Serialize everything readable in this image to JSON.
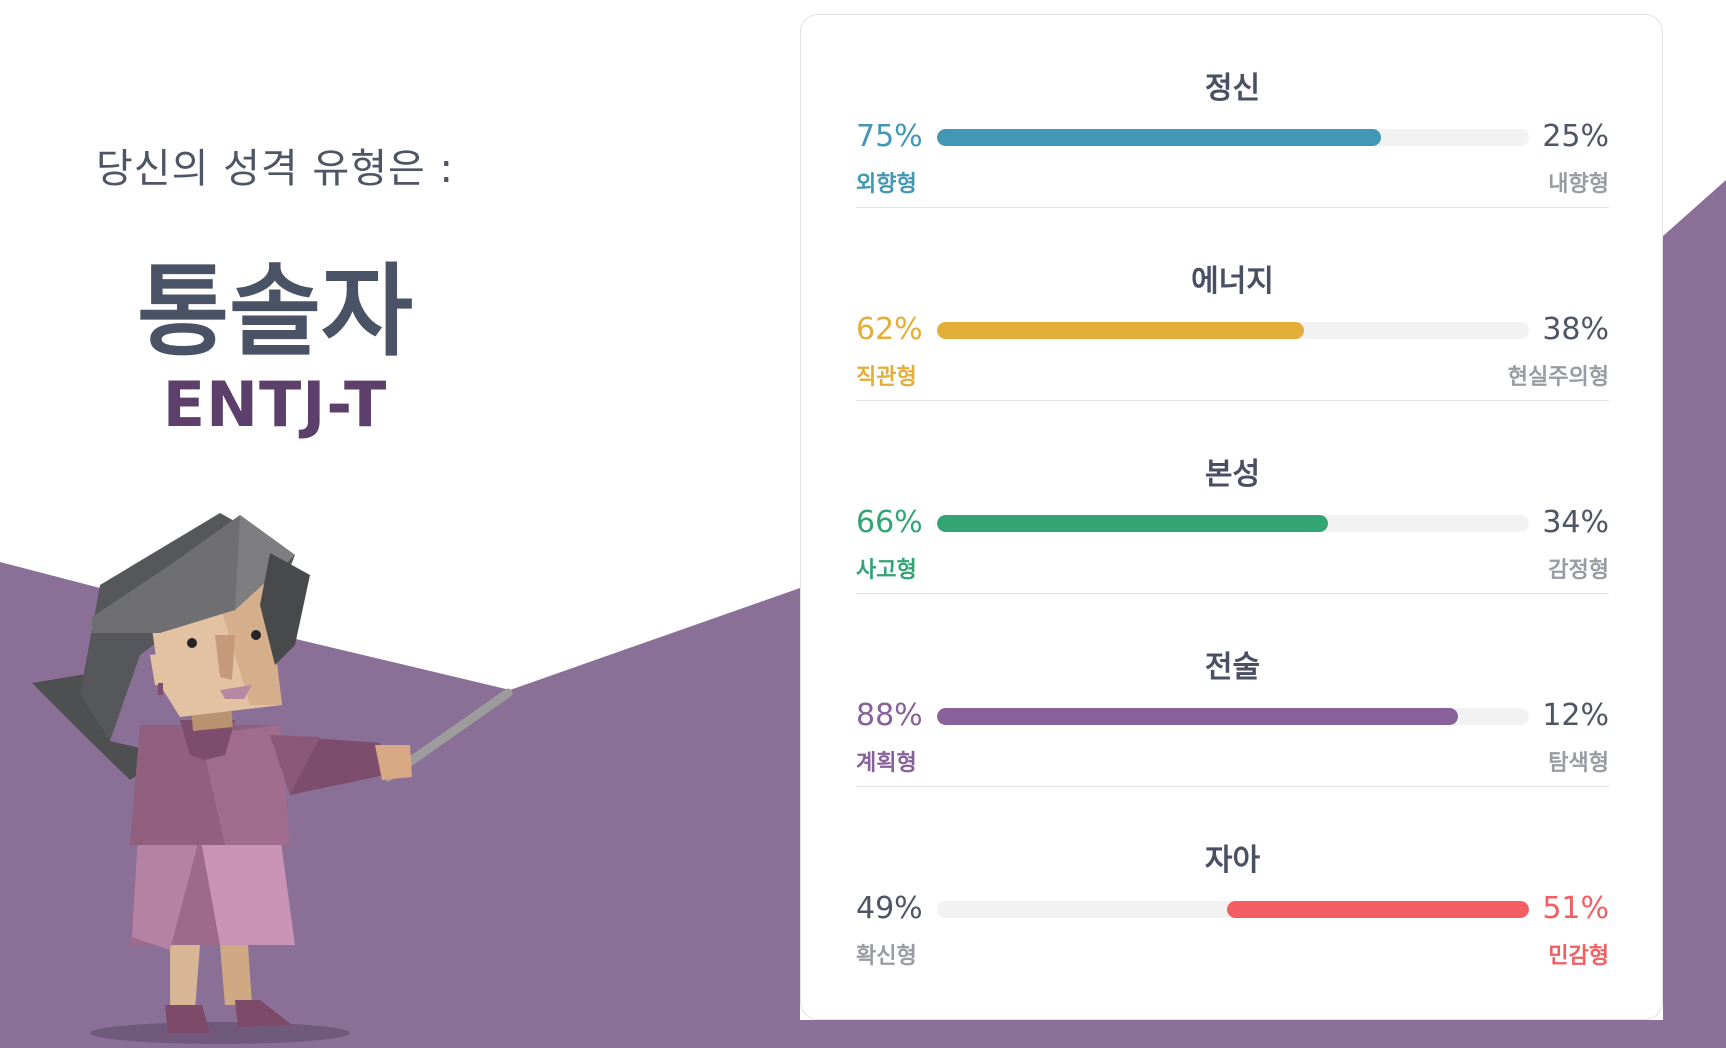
{
  "result": {
    "subtitle": "당신의 성격 유형은 :",
    "type_name": "통솔자",
    "type_code": "ENTJ-T"
  },
  "colors": {
    "background_purple": "#8a7097",
    "text_dark": "#4e5565"
  },
  "traits": [
    {
      "name": "정신",
      "left_pct": "75%",
      "right_pct": "25%",
      "left_label": "외향형",
      "right_label": "내향형",
      "value": 75,
      "dominant": "left",
      "color": "#4298b4"
    },
    {
      "name": "에너지",
      "left_pct": "62%",
      "right_pct": "38%",
      "left_label": "직관형",
      "right_label": "현실주의형",
      "value": 62,
      "dominant": "left",
      "color": "#e4ae3a"
    },
    {
      "name": "본성",
      "left_pct": "66%",
      "right_pct": "34%",
      "left_label": "사고형",
      "right_label": "감정형",
      "value": 66,
      "dominant": "left",
      "color": "#33a474"
    },
    {
      "name": "전술",
      "left_pct": "88%",
      "right_pct": "12%",
      "left_label": "계획형",
      "right_label": "탐색형",
      "value": 88,
      "dominant": "left",
      "color": "#88619a"
    },
    {
      "name": "자아",
      "left_pct": "49%",
      "right_pct": "51%",
      "left_label": "확신형",
      "right_label": "민감형",
      "value": 51,
      "dominant": "right",
      "color": "#f25e62"
    }
  ]
}
